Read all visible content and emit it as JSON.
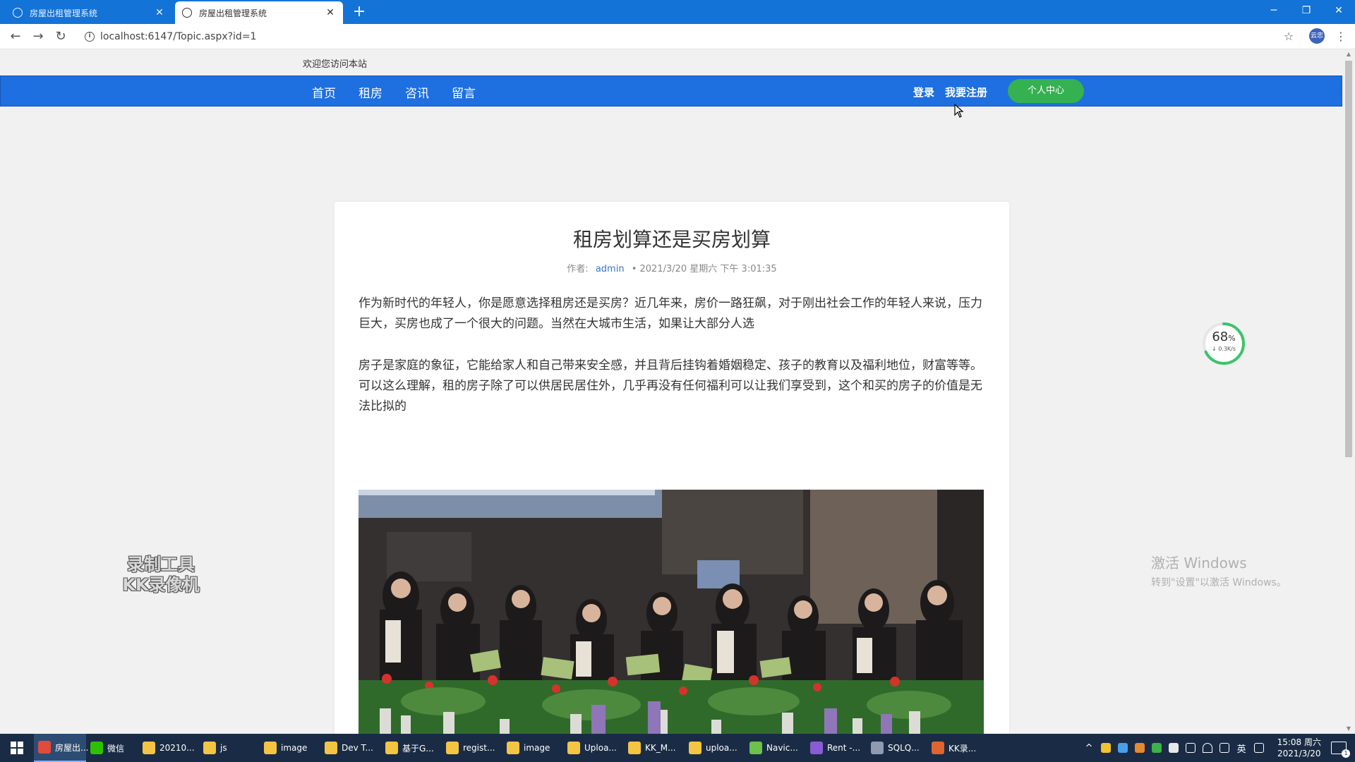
{
  "browser": {
    "tabs": [
      {
        "title": "房屋出租管理系统",
        "active": false
      },
      {
        "title": "房屋出租管理系统",
        "active": true
      }
    ],
    "tab_close_glyph": "✕",
    "new_tab_glyph": "+",
    "url": "localhost:6147/Topic.aspx?id=1",
    "profile_label": "云忠",
    "window_controls": [
      "─",
      "❐",
      "✕"
    ],
    "nav_glyphs": {
      "back": "←",
      "forward": "→",
      "reload": "↻",
      "info": "i",
      "star": "☆",
      "menu": "⋮"
    }
  },
  "site": {
    "welcome": "欢迎您访问本站",
    "nav": [
      "首页",
      "租房",
      "咨讯",
      "留言"
    ],
    "login": "登录",
    "register": "我要注册",
    "user_center": "个人中心",
    "accent_color": "#1e6fe0",
    "button_color": "#35b152"
  },
  "article": {
    "title": "租房划算还是买房划算",
    "author_label": "作者:",
    "author": "admin",
    "date": "• 2021/3/20 星期六 下午 3:01:35",
    "paragraphs": [
      "作为新时代的年轻人，你是愿意选择租房还是买房？近几年来，房价一路狂飙，对于刚出社会工作的年轻人来说，压力巨大，买房也成了一个很大的问题。当然在大城市生活，如果让大部分人选",
      "房子是家庭的象征，它能给家人和自己带来安全感，并且背后挂钩着婚姻稳定、孩子的教育以及福利地位，财富等等。可以这么理解，租的房子除了可以供居民居住外，几乎再没有任何福利可以让我们享受到，这个和买的房子的价值是无法比拟的"
    ]
  },
  "overlay": {
    "speed_percent": "68",
    "speed_unit": "%",
    "speed_rate": "↓ 0.3K/s",
    "speed_fraction": 0.68,
    "watermark_lines": [
      "录制工具",
      "KK录像机"
    ],
    "activate_title": "激活 Windows",
    "activate_sub": "转到\"设置\"以激活 Windows。"
  },
  "taskbar": {
    "items": [
      {
        "label": "房屋出...",
        "icon": "chrome-icon",
        "color": "#e24a3b",
        "active": true
      },
      {
        "label": "微信",
        "icon": "wechat-icon",
        "color": "#2dc100",
        "active": false
      },
      {
        "label": "20210...",
        "icon": "folder-icon",
        "color": "#f4c542",
        "active": false
      },
      {
        "label": "js",
        "icon": "folder-icon",
        "color": "#f4c542",
        "active": false
      },
      {
        "label": "image",
        "icon": "folder-icon",
        "color": "#f4c542",
        "active": false
      },
      {
        "label": "Dev T...",
        "icon": "folder-icon",
        "color": "#f4c542",
        "active": false
      },
      {
        "label": "基于G...",
        "icon": "folder-icon",
        "color": "#f4c542",
        "active": false
      },
      {
        "label": "regist...",
        "icon": "folder-icon",
        "color": "#f4c542",
        "active": false
      },
      {
        "label": "image",
        "icon": "folder-icon",
        "color": "#f4c542",
        "active": false
      },
      {
        "label": "Uploa...",
        "icon": "folder-icon",
        "color": "#f4c542",
        "active": false
      },
      {
        "label": "KK_M...",
        "icon": "folder-icon",
        "color": "#f4c542",
        "active": false
      },
      {
        "label": "uploa...",
        "icon": "folder-icon",
        "color": "#f4c542",
        "active": false
      },
      {
        "label": "Navic...",
        "icon": "navicat-icon",
        "color": "#6cc24a",
        "active": false
      },
      {
        "label": "Rent -...",
        "icon": "visual-studio-icon",
        "color": "#8b5bd6",
        "active": false
      },
      {
        "label": "SQLQ...",
        "icon": "sql-icon",
        "color": "#8e9bb0",
        "active": false
      },
      {
        "label": "KK录...",
        "icon": "kk-recorder-icon",
        "color": "#e0642e",
        "active": false
      }
    ],
    "tray_glyph": "^",
    "ime": "英",
    "time": "15:08 周六",
    "date": "2021/3/20",
    "notification_count": "1"
  }
}
